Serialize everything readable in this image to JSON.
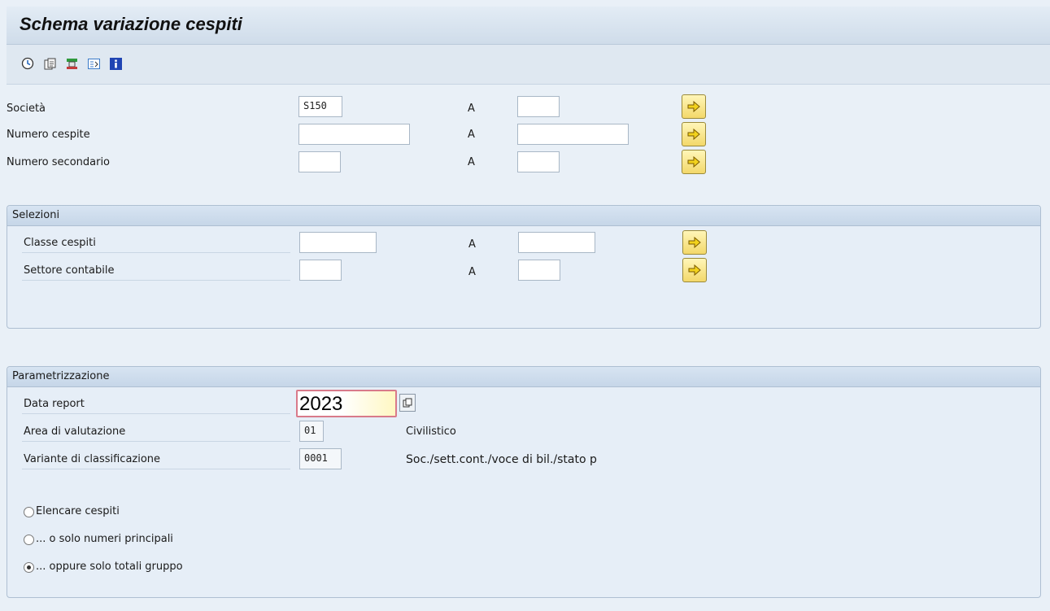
{
  "title": "Schema variazione cespiti",
  "toolbar": {
    "buttons": [
      {
        "icon": "execute-clock-icon",
        "color": "#2a6bbf"
      },
      {
        "icon": "get-variant-icon",
        "color": "#444"
      },
      {
        "icon": "selection-options-icon",
        "color": "#2f9a3c"
      },
      {
        "icon": "multiple-selection-icon",
        "color": "#3a7ac8"
      },
      {
        "icon": "info-icon",
        "color": "#1f44b3"
      }
    ]
  },
  "main": {
    "rows": [
      {
        "label": "Società",
        "from": "S150",
        "to_label": "A",
        "to": ""
      },
      {
        "label": "Numero cespite",
        "from": "",
        "to_label": "A",
        "to": ""
      },
      {
        "label": "Numero secondario",
        "from": "",
        "to_label": "A",
        "to": ""
      }
    ]
  },
  "selezioni": {
    "title": "Selezioni",
    "rows": [
      {
        "label": "Classe cespiti",
        "from": "",
        "to_label": "A",
        "to": ""
      },
      {
        "label": "Settore contabile",
        "from": "",
        "to_label": "A",
        "to": ""
      }
    ]
  },
  "param": {
    "title": "Parametrizzazione",
    "data_report": {
      "label": "Data report",
      "value": "2023"
    },
    "area": {
      "label": "Area di valutazione",
      "value": "01",
      "desc": "Civilistico"
    },
    "variante": {
      "label": "Variante di classificazione",
      "value": "0001",
      "desc": "Soc./sett.cont./voce di bil./stato p"
    },
    "options": [
      {
        "label": "Elencare cespiti",
        "selected": false
      },
      {
        "label": "... o solo numeri principali",
        "selected": false
      },
      {
        "label": "... oppure solo totali gruppo",
        "selected": true
      }
    ]
  }
}
